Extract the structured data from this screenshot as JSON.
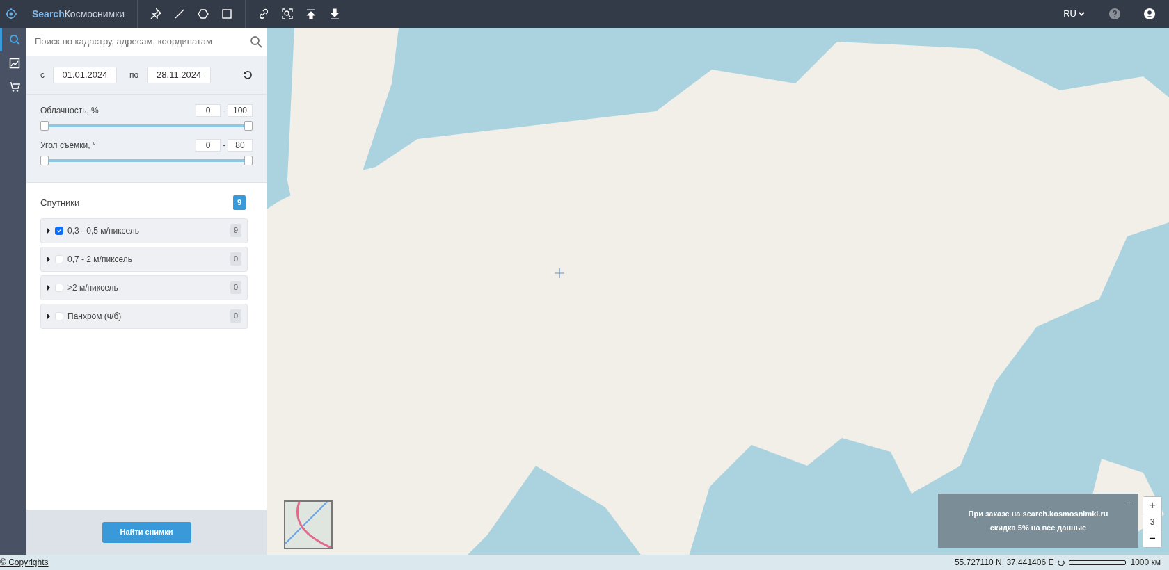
{
  "header": {
    "brand_bold": "Search",
    "brand_rest": "Космоснимки",
    "language": "RU"
  },
  "rail": [
    {
      "kind": "search",
      "selected": true
    },
    {
      "kind": "chart",
      "selected": false
    },
    {
      "kind": "cart",
      "selected": false
    }
  ],
  "search": {
    "placeholder": "Поиск по кадастру, адресам, координатам"
  },
  "dates": {
    "from_label": "с",
    "from": "01.01.2024",
    "to_label": "по",
    "to": "28.11.2024"
  },
  "ranges": [
    {
      "label": "Облачность, %",
      "min": "0",
      "separator": "-",
      "max": "100",
      "level": 1
    },
    {
      "label": "Угол съемки, °",
      "min": "0",
      "separator": "-",
      "max": "80",
      "level": 1
    }
  ],
  "satellites": {
    "title": "Спутники",
    "count": "9",
    "groups": [
      {
        "label": "0,3 - 0,5 м/пиксель",
        "checked": true,
        "count": "9"
      },
      {
        "label": "0,7 - 2 м/пиксель",
        "checked": false,
        "count": "0"
      },
      {
        "label": ">2 м/пиксель",
        "checked": false,
        "count": "0"
      },
      {
        "label": "Панхром (ч/б)",
        "checked": false,
        "count": "0"
      }
    ]
  },
  "find_button": "Найти снимки",
  "promo": {
    "collapse": "−",
    "line1": "При заказе на search.kosmosnimki.ru",
    "line2": "**скидка 5%** на все данные"
  },
  "zoom": {
    "zoom_in": "+",
    "zoom_value": "3",
    "zoom_out": "−"
  },
  "footer": {
    "copyright": "© Copyrights",
    "coordinates": "55.727110 N, 37.441406 E",
    "scale": "1000 км"
  }
}
